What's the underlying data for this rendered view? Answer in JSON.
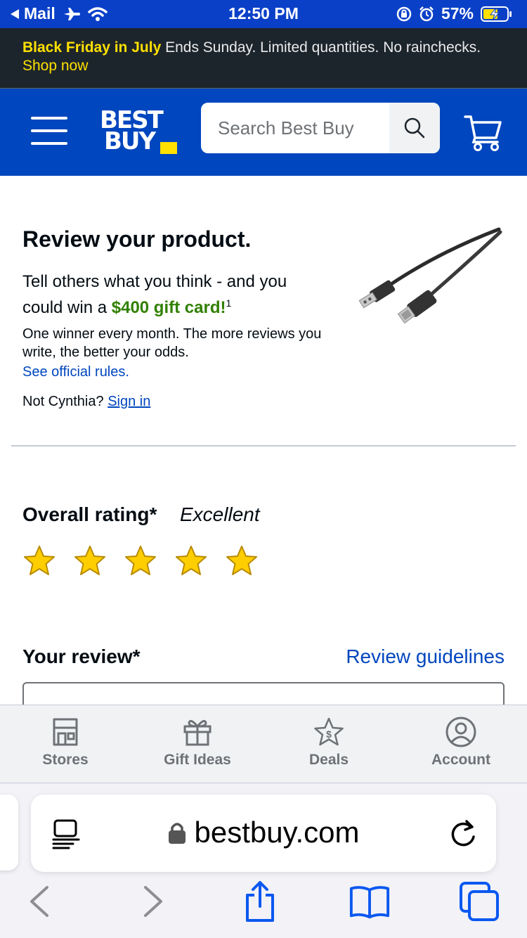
{
  "status_bar": {
    "back_app": "Mail",
    "time": "12:50 PM",
    "battery": "57%"
  },
  "promo": {
    "highlight": "Black Friday in July",
    "text": "Ends Sunday. Limited quantities. No rainchecks.",
    "link": "Shop now"
  },
  "header": {
    "logo_line1": "BEST",
    "logo_line2": "BUY",
    "search_placeholder": "Search Best Buy"
  },
  "review_intro": {
    "title": "Review your product.",
    "desc_before": "Tell others what you think - and you could win a",
    "desc_highlight": "$400 gift card!",
    "desc_sup": "1",
    "odds": "One winner every month. The more reviews you write, the better your odds.",
    "rules_link": "See official rules.",
    "not_user": "Not Cynthia?",
    "sign_in": "Sign in"
  },
  "rating": {
    "label": "Overall rating*",
    "value_label": "Excellent",
    "stars_filled": 5,
    "stars_total": 5,
    "star_color": "#ffce00"
  },
  "review": {
    "label": "Your review*",
    "guidelines_link": "Review guidelines"
  },
  "bottom_nav": {
    "items": [
      {
        "label": "Stores",
        "icon": "store-icon"
      },
      {
        "label": "Gift Ideas",
        "icon": "gift-icon"
      },
      {
        "label": "Deals",
        "icon": "deals-star-icon"
      },
      {
        "label": "Account",
        "icon": "account-icon"
      }
    ]
  },
  "browser": {
    "url": "bestbuy.com"
  },
  "colors": {
    "brand_blue": "#0046be",
    "brand_yellow": "#ffe000",
    "promo_green": "#318000"
  }
}
